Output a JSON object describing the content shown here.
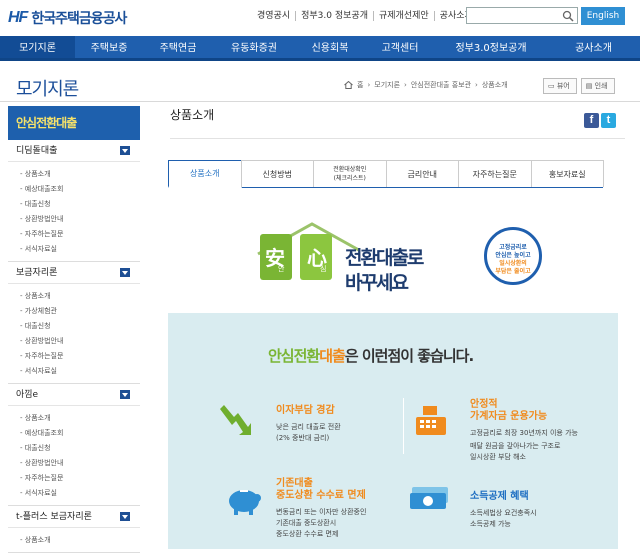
{
  "header": {
    "logo_hf": "HF",
    "logo_name": "한국주택금융공사",
    "util_links": [
      "경영공시",
      "정부3.0 정보공개",
      "규제개선제안",
      "공사소개"
    ],
    "english_label": "English"
  },
  "gnb": [
    "모기지론",
    "주택보증",
    "주택연금",
    "유동화증권",
    "신용회복",
    "고객센터",
    "정부3.0정보공개",
    "공사소개"
  ],
  "page_title": "모기지론",
  "breadcrumb": [
    "홈",
    "모기지론",
    "안심전환대출 홍보관",
    "상품소개"
  ],
  "tools": {
    "print_preview": "뷰어",
    "print": "인쇄"
  },
  "lnb": {
    "top": "안심전환대출",
    "groups": [
      {
        "title": "디딤돌대출",
        "items": [
          "상품소개",
          "예상대출조회",
          "대출신청",
          "상환방법안내",
          "자주하는질문",
          "서식자료실"
        ]
      },
      {
        "title": "보금자리론",
        "items": [
          "상품소개",
          "가상체험관",
          "대출신청",
          "상환방법안내",
          "자주하는질문",
          "서식자료실"
        ]
      },
      {
        "title": "아낌e",
        "items": [
          "상품소개",
          "예상대출조회",
          "대출신청",
          "상환방법안내",
          "자주하는질문",
          "서식자료실"
        ]
      },
      {
        "title": "t-플러스 보금자리론",
        "items": [
          "상품소개"
        ]
      }
    ]
  },
  "section_title": "상품소개",
  "sns": {
    "facebook": "f",
    "twitter": "t"
  },
  "tabs": [
    {
      "label": "상품소개"
    },
    {
      "label": "신청방법"
    },
    {
      "label": "전환대상확인\n(체크리스트)"
    },
    {
      "label": "금리안내"
    },
    {
      "label": "자주하는질문"
    },
    {
      "label": "홍보자료실"
    }
  ],
  "banner": {
    "an": "安",
    "an_sub": "안",
    "sim": "心",
    "sim_sub": "심",
    "line1": "전환대출로",
    "line2": "바꾸세요",
    "circle": [
      "고정금리로",
      "안심은 높이고",
      "일시상환의",
      "부담은 줄이고"
    ]
  },
  "panel": {
    "title_a": "안심",
    "title_b": "전환",
    "title_c": "대출",
    "title_d": "은 이런점이 좋습니다.",
    "features": [
      {
        "title": "이자부담 경감",
        "desc": [
          "낮은 금리 대출로 전환",
          "(2% 중반대 금리)"
        ]
      },
      {
        "title": "안정적\n가계자금 운용가능",
        "desc": [
          "고정금리로 최장 30년까지 이용 가능",
          "매달 원금을 갚아나가는 구조로",
          "일시상환 부담 해소"
        ]
      },
      {
        "title": "기존대출\n중도상환 수수료 면제",
        "desc": [
          "변동금리 또는 이자만 상환중인",
          "기존대출 중도상환시",
          "중도상환 수수료 면제"
        ]
      },
      {
        "title": "소득공제 혜택",
        "desc": [
          "소득세법상 요건충족시",
          "소득공제 가능"
        ]
      }
    ]
  }
}
